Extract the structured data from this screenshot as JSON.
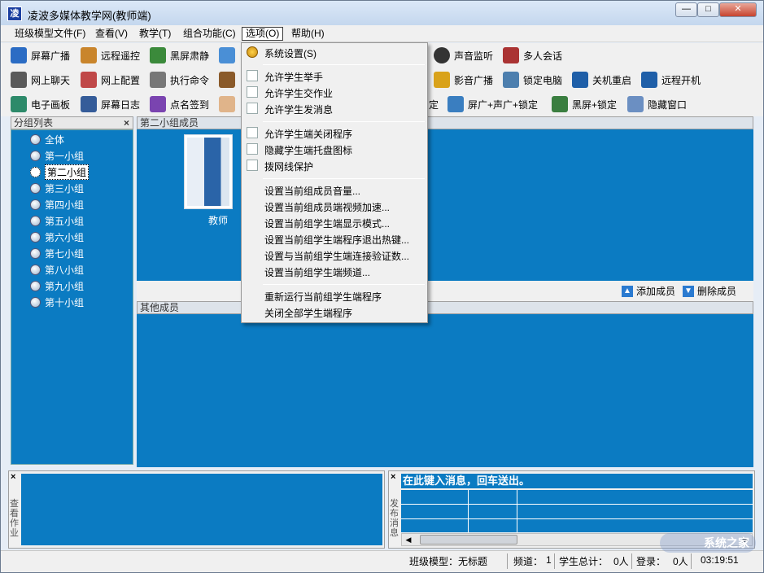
{
  "window": {
    "title": "凌波多媒体教学网(教师端)",
    "app_glyph": "凌",
    "btn_min": "—",
    "btn_max": "□",
    "btn_close": "✕"
  },
  "menu": [
    "班级模型文件(F)",
    "查看(V)",
    "教学(T)",
    "组合功能(C)",
    "选项(O)",
    "帮助(H)"
  ],
  "toolbar": {
    "row1": [
      "屏幕广播",
      "远程遥控",
      "黑屏肃静",
      "声音监听",
      "多人会话"
    ],
    "row2": [
      "网上聊天",
      "网上配置",
      "执行命令",
      "影音广播",
      "锁定电脑",
      "关机重启",
      "远程开机"
    ],
    "row3": [
      "电子画板",
      "屏幕日志",
      "点名签到",
      "定",
      "屏广+声广+锁定",
      "黑屏+锁定",
      "隐藏窗口"
    ]
  },
  "group_list": {
    "title": "分组列表",
    "close": "×",
    "items": [
      "全体",
      "第一小组",
      "第二小组",
      "第三小组",
      "第四小组",
      "第五小组",
      "第六小组",
      "第七小组",
      "第八小组",
      "第九小组",
      "第十小组"
    ],
    "selected_index": 2
  },
  "members_panel": {
    "title": "第二小组成员",
    "teacher_label": "教师",
    "add": "添加成员",
    "remove": "删除成员"
  },
  "other_panel": {
    "title": "其他成员"
  },
  "dropdown": {
    "system": "系统设置(S)",
    "checks": [
      "允许学生举手",
      "允许学生交作业",
      "允许学生发消息",
      "允许学生端关闭程序",
      "隐藏学生端托盘图标",
      "拨网线保护"
    ],
    "sets": [
      "设置当前组成员音量...",
      "设置当前组成员端视频加速...",
      "设置当前组学生端显示模式...",
      "设置当前组学生端程序退出热键...",
      "设置与当前组学生端连接验证数...",
      "设置当前组学生端频道..."
    ],
    "tail": [
      "重新运行当前组学生端程序",
      "关闭全部学生端程序"
    ]
  },
  "bottom": {
    "left_label": "查看作业",
    "right_label": "发布消息",
    "close": "×",
    "msg": "在此键入消息，回车送出。"
  },
  "status": {
    "model": "班级模型：无标题",
    "channel": "频道：",
    "channel_val": "1",
    "total": "学生总计：",
    "total_val": "0人",
    "login": "登录：",
    "login_val": "0人",
    "time": "03:19:51"
  },
  "watermark": "系统之家"
}
